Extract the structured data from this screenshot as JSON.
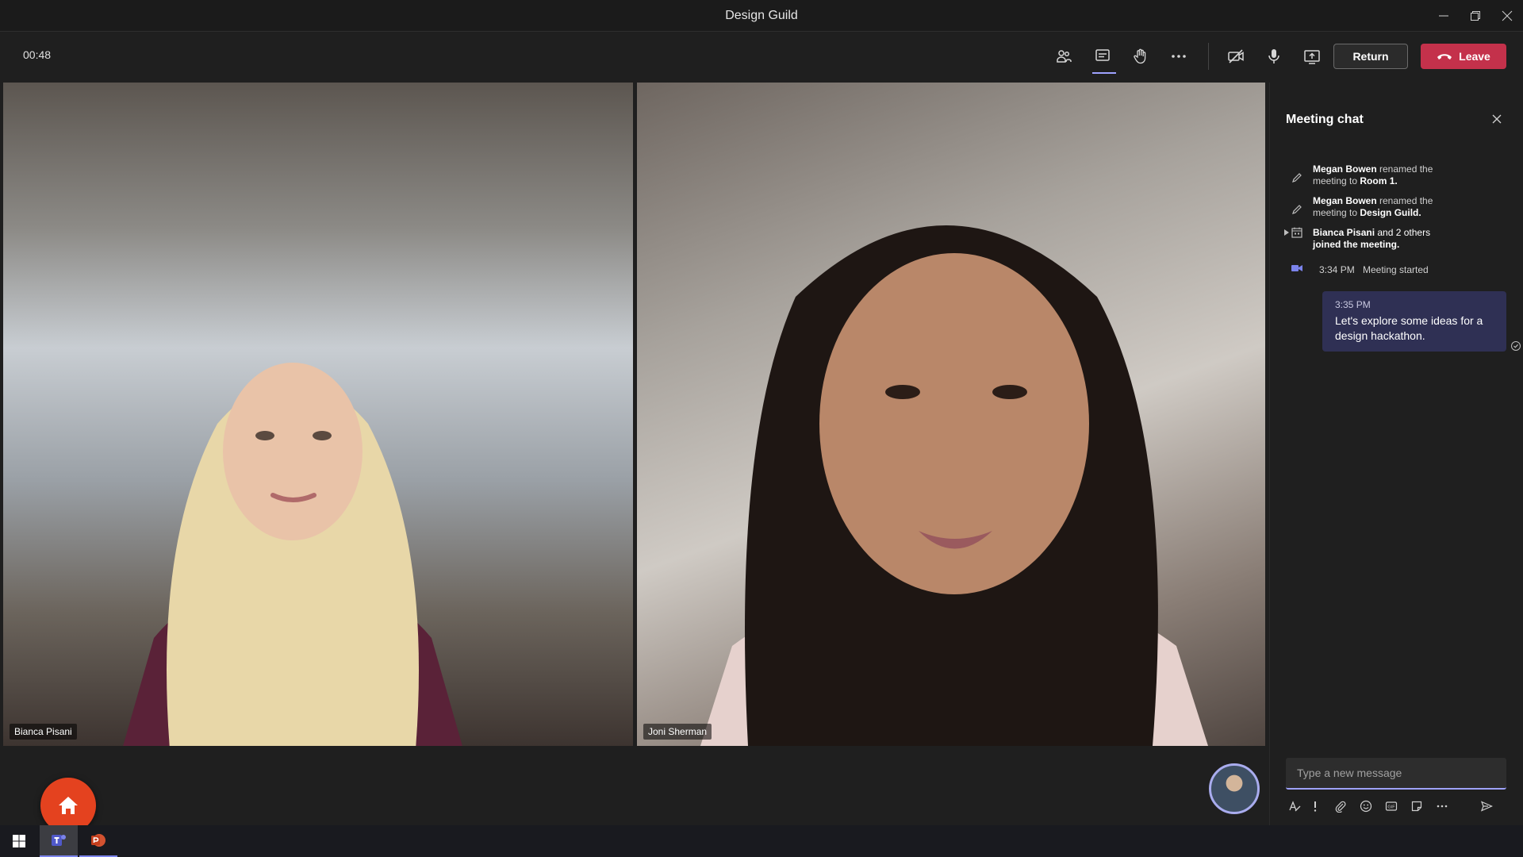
{
  "window": {
    "title": "Design Guild"
  },
  "toolbar": {
    "timer": "00:48",
    "return_label": "Return",
    "leave_label": "Leave",
    "icons": [
      "participants-icon",
      "chat-icon",
      "raise-hand-icon",
      "more-actions-icon",
      "camera-off-icon",
      "microphone-icon",
      "share-screen-icon"
    ]
  },
  "video": {
    "tiles": [
      {
        "name": "Bianca Pisani"
      },
      {
        "name": "Joni Sherman"
      }
    ]
  },
  "chat": {
    "title": "Meeting chat",
    "events": [
      {
        "actor": "Megan Bowen",
        "text1": " renamed the",
        "text2": "meeting to ",
        "value": "Room 1."
      },
      {
        "actor": "Megan Bowen",
        "text1": " renamed the",
        "text2": "meeting to ",
        "value": "Design Guild."
      },
      {
        "actor": "Bianca Pisani",
        "text1": " and 2 others",
        "text2": "joined the meeting."
      }
    ],
    "started": {
      "time": "3:34 PM",
      "text": "Meeting started"
    },
    "message": {
      "time": "3:35 PM",
      "text": "Let's explore some ideas for a design hackathon."
    },
    "compose_placeholder": "Type a new message"
  },
  "colors": {
    "accent": "#9ea2ff",
    "leave_red": "#c4314b",
    "bubble": "#2f3054",
    "home_orange": "#e4421f"
  }
}
